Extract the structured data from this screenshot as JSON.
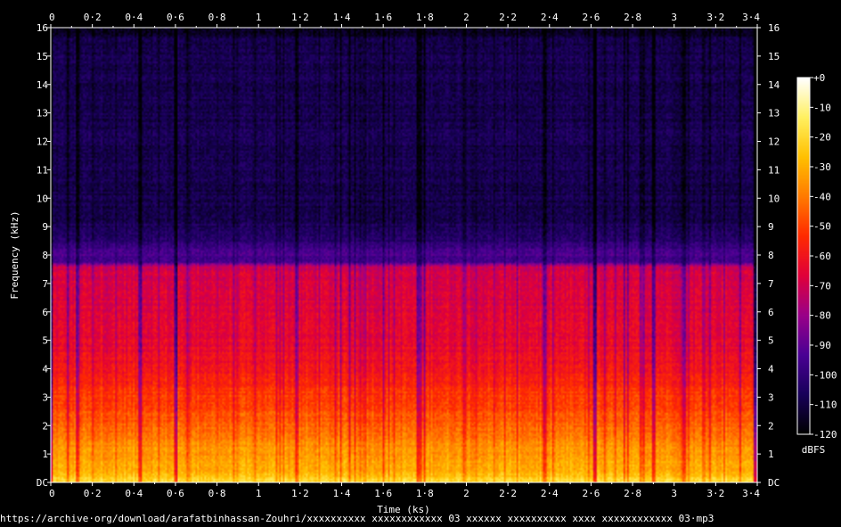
{
  "chart_data": {
    "type": "heatmap",
    "xlabel": "Time (ks)",
    "ylabel": "Frequency (kHz)",
    "xlim": [
      0,
      3.4
    ],
    "ylim": [
      0,
      16
    ],
    "x_ticks": [
      "0",
      "0·2",
      "0·4",
      "0·6",
      "0·8",
      "1",
      "1·2",
      "1·4",
      "1·6",
      "1·8",
      "2",
      "2·2",
      "2·4",
      "2·6",
      "2·8",
      "3",
      "3·2",
      "3·4"
    ],
    "y_ticks": [
      "DC",
      "1",
      "2",
      "3",
      "4",
      "5",
      "6",
      "7",
      "8",
      "9",
      "10",
      "11",
      "12",
      "13",
      "14",
      "15",
      "16"
    ],
    "colorbar": {
      "label": "dBFS",
      "range": [
        -120,
        0
      ],
      "ticks": [
        "+0",
        "-10",
        "-20",
        "-30",
        "-40",
        "-50",
        "-60",
        "-70",
        "-80",
        "-90",
        "-100",
        "-110",
        "-120"
      ],
      "colors": [
        "#000000",
        "#18005a",
        "#4a0094",
        "#9a0088",
        "#e0003a",
        "#ff2a00",
        "#ff7a00",
        "#ffc000",
        "#fff060",
        "#ffffff"
      ]
    },
    "spectrum_profile_khz_dbfs": [
      [
        0,
        -18
      ],
      [
        0.3,
        -28
      ],
      [
        0.8,
        -33
      ],
      [
        1.5,
        -38
      ],
      [
        2.0,
        -44
      ],
      [
        2.5,
        -48
      ],
      [
        3.2,
        -52
      ],
      [
        4.0,
        -60
      ],
      [
        5.0,
        -64
      ],
      [
        6.0,
        -66
      ],
      [
        7.0,
        -68
      ],
      [
        7.6,
        -70
      ],
      [
        7.75,
        -96
      ],
      [
        8.0,
        -93
      ],
      [
        8.3,
        -98
      ],
      [
        8.6,
        -104
      ],
      [
        9.5,
        -109
      ],
      [
        12.0,
        -108
      ],
      [
        15.0,
        -108
      ],
      [
        15.6,
        -110
      ],
      [
        16.0,
        -118
      ]
    ],
    "dropout_times_ks": [
      0.08,
      0.13,
      0.43,
      0.6,
      1.18,
      1.77,
      1.78,
      1.8,
      2.38,
      2.62,
      2.76,
      2.9,
      3.05,
      3.32
    ]
  },
  "footer": {
    "source": "https://archive·org/download/arafatbinhassan-Zouhri/xxxxxxxxxx xxxxxxxxxxxx 03 xxxxxx xxxxxxxxxx xxxx xxxxxxxxxxxx 03·mp3"
  }
}
